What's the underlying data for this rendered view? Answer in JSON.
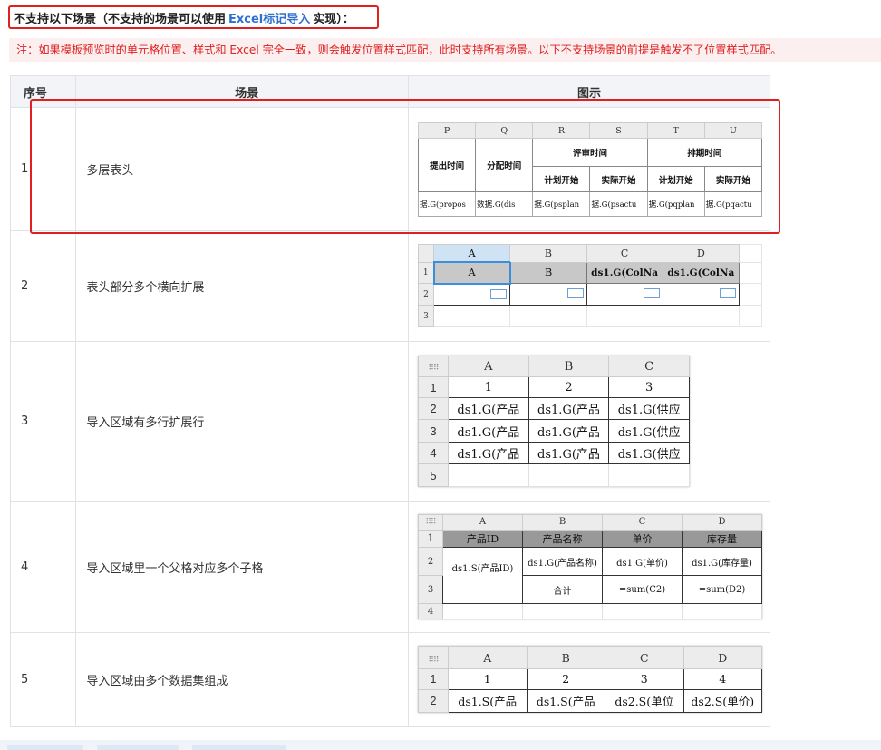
{
  "heading": {
    "prefix": "不支持以下场景（不支持的场景可以使用",
    "link": "Excel标记导入",
    "suffix": "实现）："
  },
  "note": "注：如果模板预览时的单元格位置、样式和 Excel 完全一致，则会触发位置样式匹配，此时支持所有场景。以下不支持场景的前提是触发不了位置样式匹配。",
  "table": {
    "headers": [
      "序号",
      "场景",
      "图示"
    ],
    "rows": [
      {
        "num": "1",
        "scene": "多层表头"
      },
      {
        "num": "2",
        "scene": "表头部分多个横向扩展"
      },
      {
        "num": "3",
        "scene": "导入区域有多行扩展行"
      },
      {
        "num": "4",
        "scene": "导入区域里一个父格对应多个子格"
      },
      {
        "num": "5",
        "scene": "导入区域由多个数据集组成"
      }
    ]
  },
  "shot1": {
    "cols": [
      "P",
      "Q",
      "R",
      "S",
      "T",
      "U"
    ],
    "h_submit": "提出时间",
    "h_assign": "分配时间",
    "h_review": "评审时间",
    "h_schedule": "排期时间",
    "h_plan_start": "计划开始",
    "h_actual_start": "实际开始",
    "cells": [
      "据.G(propos",
      "数据.G(dis",
      "据.G(psplan",
      "据.G(psactu",
      "据.G(pqplan",
      "据.G(pqactu"
    ]
  },
  "shot2": {
    "cols": [
      "A",
      "B",
      "C",
      "D"
    ],
    "rows": [
      "1",
      "2",
      "3"
    ],
    "r1": [
      "A",
      "B",
      "ds1.G(ColNa",
      "ds1.G(ColNa"
    ]
  },
  "shot3": {
    "cols": [
      "A",
      "B",
      "C"
    ],
    "rows": [
      "1",
      "2",
      "3",
      "4",
      "5"
    ],
    "r1": [
      "1",
      "2",
      "3"
    ],
    "cell_a": "ds1.G(产品",
    "cell_c": "ds1.G(供应"
  },
  "shot4": {
    "cols": [
      "A",
      "B",
      "C",
      "D"
    ],
    "rows": [
      "1",
      "2",
      "3",
      "4"
    ],
    "headers": [
      "产品ID",
      "产品名称",
      "单价",
      "库存量"
    ],
    "a2": "ds1.S(产品ID)",
    "b2": "ds1.G(产品名称)",
    "c2": "ds1.G(单价)",
    "d2": "ds1.G(库存量)",
    "b3": "合计",
    "c3": "=sum(C2)",
    "d3": "=sum(D2)"
  },
  "shot5": {
    "cols": [
      "A",
      "B",
      "C",
      "D"
    ],
    "rows": [
      "1",
      "2"
    ],
    "r1": [
      "1",
      "2",
      "3",
      "4"
    ],
    "r2": [
      "ds1.S(产品",
      "ds1.S(产品",
      "ds2.S(单位",
      "ds2.S(单价)"
    ]
  }
}
